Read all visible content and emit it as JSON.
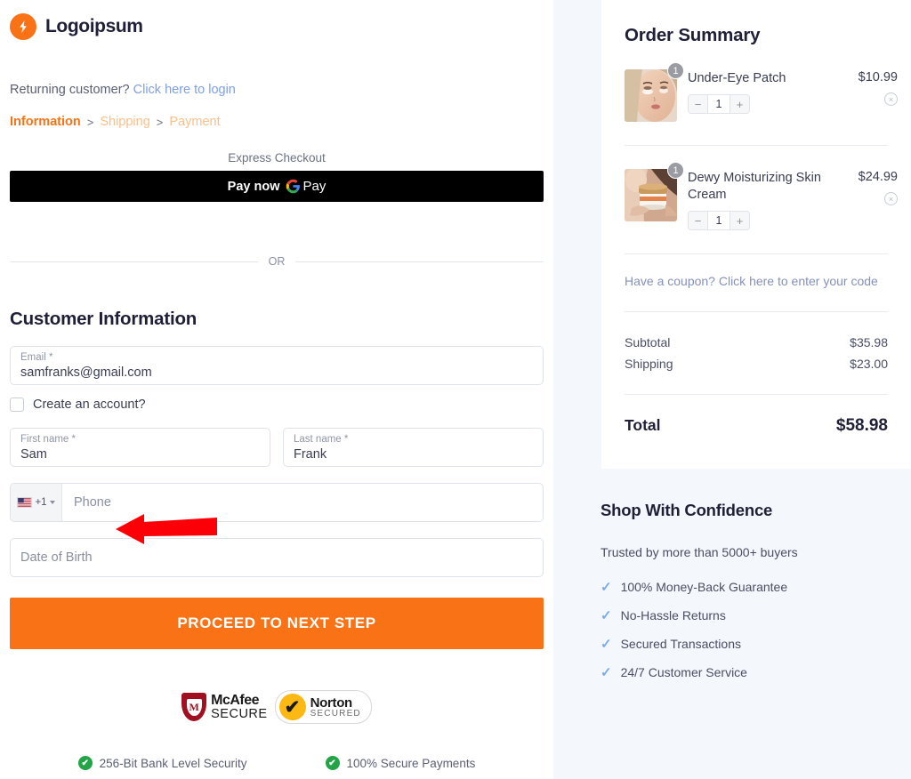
{
  "brand": {
    "name": "Logoipsum"
  },
  "login": {
    "prompt": "Returning customer?",
    "link": "Click here to login"
  },
  "breadcrumb": {
    "active": "Information",
    "separator": ">",
    "step2": "Shipping",
    "step3": "Payment",
    "active_color": "#f97316",
    "inactive_color": "#fbbf8a"
  },
  "express": {
    "label": "Express Checkout",
    "paynow": "Pay now",
    "gpay_g": "G",
    "gpay_pay": "Pay",
    "or": "OR"
  },
  "customer": {
    "title": "Customer Information",
    "email_label": "Email *",
    "email_value": "samfranks@gmail.com",
    "create_account_label": "Create an account?",
    "first_name_label": "First name *",
    "first_name_value": "Sam",
    "last_name_label": "Last name *",
    "last_name_value": "Frank",
    "country_code": "+1",
    "phone_placeholder": "Phone",
    "dob_placeholder": "Date of Birth",
    "proceed_label": "PROCEED TO NEXT STEP",
    "proceed_color": "#f97316"
  },
  "badges": {
    "mcafee_letter": "M",
    "mcafee_line1": "McAfee",
    "mcafee_line2": "SECURE",
    "norton_check": "✔",
    "norton_line1": "Norton",
    "norton_line2": "SECURED",
    "check_glyph": "✔",
    "security1": "256-Bit Bank Level Security",
    "security2": "100% Secure Payments"
  },
  "order": {
    "title": "Order Summary",
    "items": [
      {
        "name": "Under-Eye Patch",
        "price": "$10.99",
        "qty": "1",
        "badge": "1",
        "minus": "−",
        "plus": "+",
        "remove": "×"
      },
      {
        "name": "Dewy Moisturizing Skin Cream",
        "price": "$24.99",
        "qty": "1",
        "badge": "1",
        "minus": "−",
        "plus": "+",
        "remove": "×"
      }
    ],
    "coupon": "Have a coupon? Click here to enter your code",
    "subtotal_label": "Subtotal",
    "subtotal_value": "$35.98",
    "shipping_label": "Shipping",
    "shipping_value": "$23.00",
    "total_label": "Total",
    "total_value": "$58.98"
  },
  "confidence": {
    "title": "Shop With Confidence",
    "subtitle": "Trusted by more than 5000+ buyers",
    "check_glyph": "✓",
    "items": [
      "100% Money-Back Guarantee",
      "No-Hassle Returns",
      "Secured Transactions",
      "24/7 Customer Service"
    ]
  },
  "annotation": {
    "arrow_color": "#fb0007"
  }
}
